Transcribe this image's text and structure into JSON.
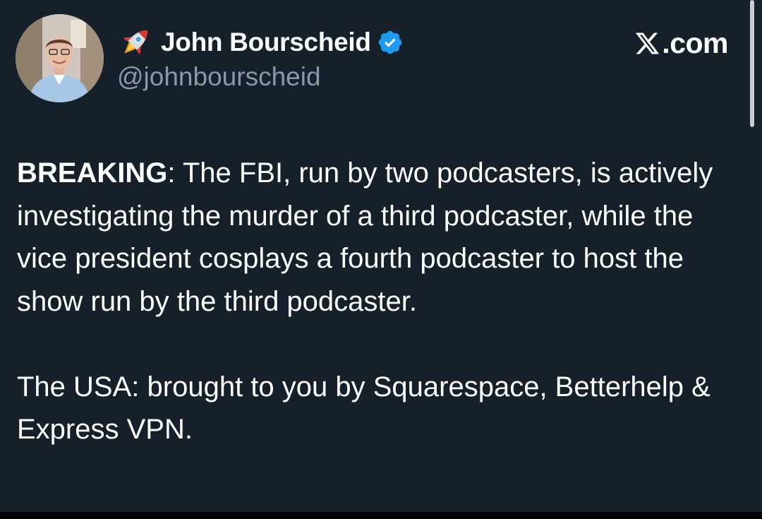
{
  "post": {
    "author": {
      "display_name": "John Bourscheid",
      "handle": "@johnbourscheid",
      "name_emoji_icon": "rocket-icon",
      "verified_icon": "verified-badge-icon",
      "avatar_icon": "profile-photo-avatar"
    },
    "brand": {
      "logo_icon": "x-logo-icon",
      "text": ".com"
    },
    "paragraph_1": {
      "lead": "BREAKING",
      "rest": ": The FBI, run by two podcasters, is actively investigating the murder of a third podcaster, while the vice president cosplays a fourth podcaster to host the show run by the third podcaster."
    },
    "paragraph_2": "The USA: brought to you by Squarespace, Betterhelp & Express VPN."
  },
  "colors": {
    "background": "#15202b",
    "text_primary": "#ffffff",
    "text_secondary": "#8b98a5",
    "verified_blue": "#1d9bf0"
  }
}
